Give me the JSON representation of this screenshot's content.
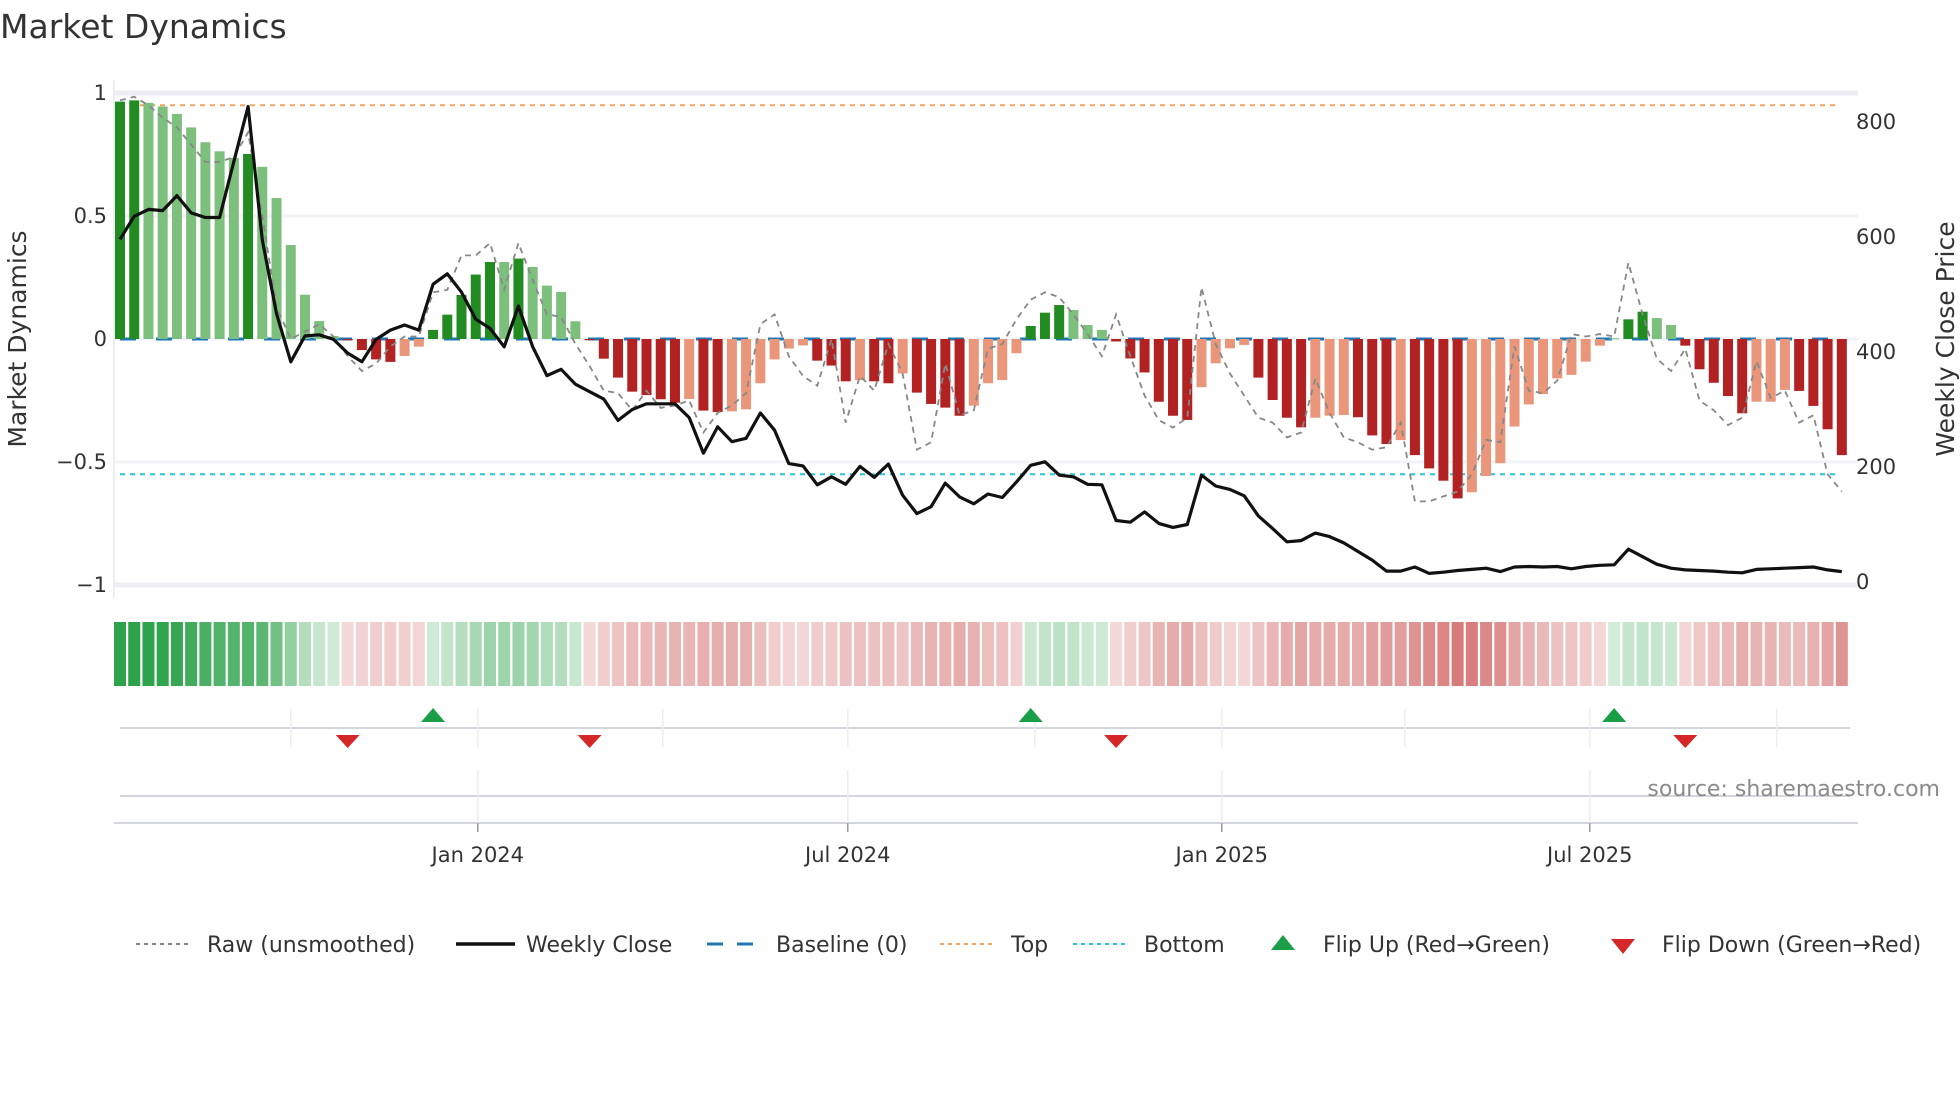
{
  "title": "Market Dynamics",
  "source": "source: sharemaestro.com",
  "legend": {
    "raw": "Raw (unsmoothed)",
    "close": "Weekly Close",
    "baseline": "Baseline (0)",
    "top": "Top",
    "bottom": "Bottom",
    "flip_up": "Flip Up (Red→Green)",
    "flip_down": "Flip Down (Green→Red)"
  },
  "colors": {
    "pos_strong": "#228b22",
    "pos_weak": "#7dbf7d",
    "neg_strong": "#b22222",
    "neg_weak": "#e9967a",
    "raw": "#888888",
    "close": "#111111",
    "baseline": "#1f77b4",
    "top": "#f4a460",
    "bottom": "#29c5d6",
    "flip_up": "#1a9e48",
    "flip_down": "#d62728"
  },
  "chart_data": {
    "type": "bar",
    "title": "Market Dynamics",
    "ylabel": "Market Dynamics",
    "y2label": "Weekly Close Price",
    "ylim": [
      -1,
      1
    ],
    "y2lim": [
      0,
      850
    ],
    "yticks": [
      {
        "v": 1,
        "label": "1"
      },
      {
        "v": 0.5,
        "label": "0.5"
      },
      {
        "v": 0,
        "label": "0"
      },
      {
        "v": -0.5,
        "label": "−0.5"
      },
      {
        "v": -1,
        "label": "−1"
      }
    ],
    "y2ticks": [
      {
        "v": 0,
        "label": "0"
      },
      {
        "v": 200,
        "label": "200"
      },
      {
        "v": 400,
        "label": "400"
      },
      {
        "v": 600,
        "label": "600"
      },
      {
        "v": 800,
        "label": "800"
      }
    ],
    "xticks": [
      {
        "date": "2024-01-01",
        "label": "Jan 2024"
      },
      {
        "date": "2024-07-01",
        "label": "Jul 2024"
      },
      {
        "date": "2025-01-01",
        "label": "Jan 2025"
      },
      {
        "date": "2025-07-01",
        "label": "Jul 2025"
      }
    ],
    "start_date": "2023-07-09",
    "interval_days": 7,
    "top_level": 0.95,
    "bottom_level": -0.55,
    "baseline": 0,
    "dynamics": [
      0.965,
      0.97,
      0.96,
      0.945,
      0.915,
      0.86,
      0.8,
      0.763,
      0.736,
      0.752,
      0.7,
      0.573,
      0.382,
      0.18,
      0.073,
      0.012,
      -0.005,
      -0.045,
      -0.083,
      -0.093,
      -0.069,
      -0.031,
      0.037,
      0.099,
      0.179,
      0.262,
      0.313,
      0.313,
      0.327,
      0.293,
      0.217,
      0.191,
      0.072,
      -0.005,
      -0.08,
      -0.157,
      -0.214,
      -0.228,
      -0.245,
      -0.259,
      -0.244,
      -0.291,
      -0.297,
      -0.294,
      -0.286,
      -0.18,
      -0.083,
      -0.039,
      -0.026,
      -0.088,
      -0.108,
      -0.172,
      -0.167,
      -0.172,
      -0.18,
      -0.14,
      -0.218,
      -0.264,
      -0.279,
      -0.312,
      -0.271,
      -0.18,
      -0.167,
      -0.058,
      0.053,
      0.107,
      0.138,
      0.118,
      0.057,
      0.037,
      -0.01,
      -0.079,
      -0.136,
      -0.255,
      -0.312,
      -0.329,
      -0.196,
      -0.099,
      -0.038,
      -0.024,
      -0.157,
      -0.248,
      -0.32,
      -0.359,
      -0.32,
      -0.312,
      -0.309,
      -0.318,
      -0.392,
      -0.427,
      -0.411,
      -0.472,
      -0.526,
      -0.576,
      -0.648,
      -0.623,
      -0.557,
      -0.505,
      -0.356,
      -0.266,
      -0.224,
      -0.16,
      -0.146,
      -0.092,
      -0.027,
      0.003,
      0.08,
      0.111,
      0.085,
      0.057,
      -0.027,
      -0.123,
      -0.178,
      -0.232,
      -0.302,
      -0.255,
      -0.255,
      -0.207,
      -0.211,
      -0.272,
      -0.367,
      -0.472
    ],
    "strengthening": "ddllllllldlllllldddd lldddddldl lllddddddd lddlllllld ddlddldddd lllldddlll ddddddllll ddddlllddd lddddlllll llllllddll dddddllldddd",
    "raw": [
      0.97,
      0.985,
      0.95,
      0.9,
      0.86,
      0.79,
      0.72,
      0.72,
      0.74,
      0.84,
      0.5,
      0.13,
      0.0,
      0.03,
      0.06,
      0.01,
      -0.07,
      -0.13,
      -0.1,
      -0.03,
      0.01,
      0.01,
      0.19,
      0.2,
      0.34,
      0.34,
      0.39,
      0.2,
      0.39,
      0.24,
      0.1,
      0.09,
      -0.02,
      -0.11,
      -0.21,
      -0.22,
      -0.29,
      -0.21,
      -0.28,
      -0.27,
      -0.25,
      -0.38,
      -0.3,
      -0.27,
      -0.22,
      0.06,
      0.1,
      -0.07,
      -0.15,
      -0.19,
      0.0,
      -0.34,
      -0.15,
      -0.21,
      -0.02,
      -0.14,
      -0.45,
      -0.42,
      -0.1,
      -0.31,
      -0.29,
      -0.04,
      -0.02,
      0.08,
      0.16,
      0.19,
      0.17,
      0.1,
      0.02,
      -0.07,
      0.1,
      -0.07,
      -0.23,
      -0.33,
      -0.36,
      -0.32,
      0.21,
      -0.02,
      -0.14,
      -0.23,
      -0.32,
      -0.34,
      -0.4,
      -0.38,
      -0.16,
      -0.3,
      -0.4,
      -0.42,
      -0.45,
      -0.44,
      -0.34,
      -0.66,
      -0.66,
      -0.64,
      -0.62,
      -0.55,
      -0.41,
      -0.42,
      -0.03,
      -0.21,
      -0.22,
      -0.17,
      0.02,
      0.01,
      0.02,
      0.01,
      0.31,
      0.1,
      -0.08,
      -0.13,
      -0.04,
      -0.25,
      -0.29,
      -0.35,
      -0.32,
      -0.09,
      -0.24,
      -0.21,
      -0.34,
      -0.31,
      -0.55,
      -0.62
    ],
    "weekly_close": [
      596,
      636,
      648,
      646,
      672,
      642,
      634,
      634,
      731,
      827,
      595,
      467,
      383,
      428,
      430,
      422,
      398,
      383,
      422,
      438,
      447,
      438,
      518,
      536,
      504,
      457,
      441,
      409,
      480,
      409,
      359,
      370,
      344,
      331,
      318,
      281,
      300,
      310,
      310,
      310,
      286,
      224,
      270,
      244,
      250,
      294,
      264,
      206,
      202,
      169,
      183,
      170,
      201,
      182,
      205,
      151,
      119,
      131,
      172,
      148,
      136,
      153,
      147,
      174,
      203,
      209,
      186,
      183,
      170,
      169,
      107,
      104,
      122,
      102,
      95,
      100,
      186,
      167,
      161,
      150,
      115,
      93,
      70,
      72,
      85,
      79,
      68,
      53,
      38,
      19,
      19,
      26,
      15,
      17,
      20,
      22,
      24,
      18,
      26,
      27,
      26,
      27,
      23,
      27,
      29,
      30,
      57,
      44,
      31,
      24,
      21,
      20,
      19,
      17,
      16,
      22,
      23,
      24,
      25,
      26,
      21,
      18
    ],
    "flip_up_weeks": [
      22,
      64,
      105
    ],
    "flip_down_weeks": [
      16,
      33,
      70,
      110
    ],
    "legend_position": "bottom"
  }
}
